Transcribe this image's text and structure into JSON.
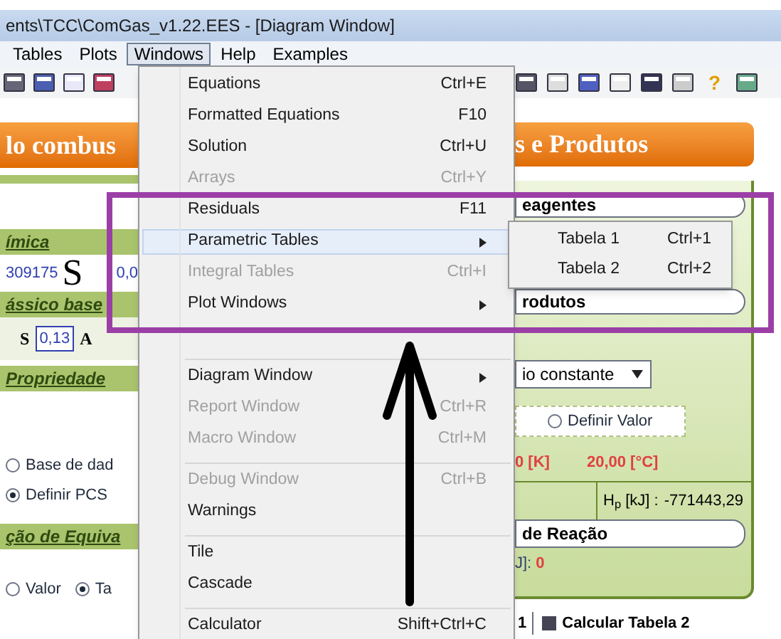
{
  "window": {
    "title": "ents\\TCC\\ComGas_v1.22.EES - [Diagram Window]"
  },
  "menubar": [
    {
      "label": "Tables",
      "selected": false
    },
    {
      "label": "Plots",
      "selected": false
    },
    {
      "label": "Windows",
      "selected": true
    },
    {
      "label": "Help",
      "selected": false
    },
    {
      "label": "Examples",
      "selected": false
    }
  ],
  "toolbar": {
    "help": "?"
  },
  "windows_menu": [
    {
      "kind": "item",
      "label": "Equations",
      "shortcut": "Ctrl+E",
      "disabled": false,
      "selected": false
    },
    {
      "kind": "item",
      "label": "Formatted Equations",
      "shortcut": "F10",
      "disabled": false,
      "selected": false
    },
    {
      "kind": "item",
      "label": "Solution",
      "shortcut": "Ctrl+U",
      "disabled": false,
      "selected": false
    },
    {
      "kind": "item",
      "label": "Arrays",
      "shortcut": "Ctrl+Y",
      "disabled": true,
      "selected": false
    },
    {
      "kind": "item",
      "label": "Residuals",
      "shortcut": "F11",
      "disabled": false,
      "selected": false
    },
    {
      "kind": "submenu",
      "label": "Parametric Tables",
      "disabled": false,
      "selected": true
    },
    {
      "kind": "item",
      "label": "Integral Tables",
      "shortcut": "Ctrl+I",
      "disabled": true,
      "selected": false
    },
    {
      "kind": "submenu",
      "label": "Plot Windows",
      "disabled": false,
      "selected": false
    },
    {
      "kind": "obscured"
    },
    {
      "kind": "separator"
    },
    {
      "kind": "submenu",
      "label": "Diagram Window",
      "disabled": false,
      "selected": false
    },
    {
      "kind": "item",
      "label": "Report Window",
      "shortcut": "Ctrl+R",
      "disabled": true,
      "selected": false
    },
    {
      "kind": "item",
      "label": "Macro Window",
      "shortcut": "Ctrl+M",
      "disabled": true,
      "selected": false
    },
    {
      "kind": "separator"
    },
    {
      "kind": "item",
      "label": "Debug Window",
      "shortcut": "Ctrl+B",
      "disabled": true,
      "selected": false
    },
    {
      "kind": "item",
      "label": "Warnings",
      "disabled": false,
      "selected": false
    },
    {
      "kind": "separator"
    },
    {
      "kind": "item",
      "label": "Tile",
      "disabled": false,
      "selected": false
    },
    {
      "kind": "item",
      "label": "Cascade",
      "disabled": false,
      "selected": false
    },
    {
      "kind": "separator"
    },
    {
      "kind": "item",
      "label": "Calculator",
      "shortcut": "Shift+Ctrl+C",
      "disabled": false,
      "selected": false
    }
  ],
  "submenu": [
    {
      "label": "Tabela 1",
      "shortcut": "Ctrl+1"
    },
    {
      "label": "Tabela 2",
      "shortcut": "Ctrl+2"
    }
  ],
  "left_panel": {
    "banner": "lo combus",
    "section_1": "ímica",
    "value_1": "309175",
    "symbol": "S",
    "value_2": "0,0",
    "section_2": "ássico base",
    "s_label": "S",
    "s_value": "0,13",
    "a_label": "A",
    "section_3": "Propriedade",
    "radios_1": [
      {
        "label": "Base de dad",
        "selected": false
      },
      {
        "label": "Definir PCS",
        "selected": true
      }
    ],
    "section_4": "ção de Equiva",
    "radios_2": [
      {
        "label": "Valor",
        "selected": false
      },
      {
        "label": "Ta",
        "selected": true
      }
    ]
  },
  "right_panel": {
    "banner": "s e Produtos",
    "reagents": "eagentes",
    "products": "rodutos",
    "dropdown": "io constante",
    "radio": {
      "label": "Definir Valor",
      "selected": false
    },
    "temp_k": "0 [K]",
    "temp_c": "20,00 [°C]",
    "enthalpy_label": "H$_{p}$ [kJ] :",
    "enthalpy_value": "-771443,29",
    "reaction": "de Reação",
    "heat_label": "J]:",
    "heat_value": "0",
    "tab_number": "1",
    "tab_button": "Calcular Tabela 2"
  }
}
